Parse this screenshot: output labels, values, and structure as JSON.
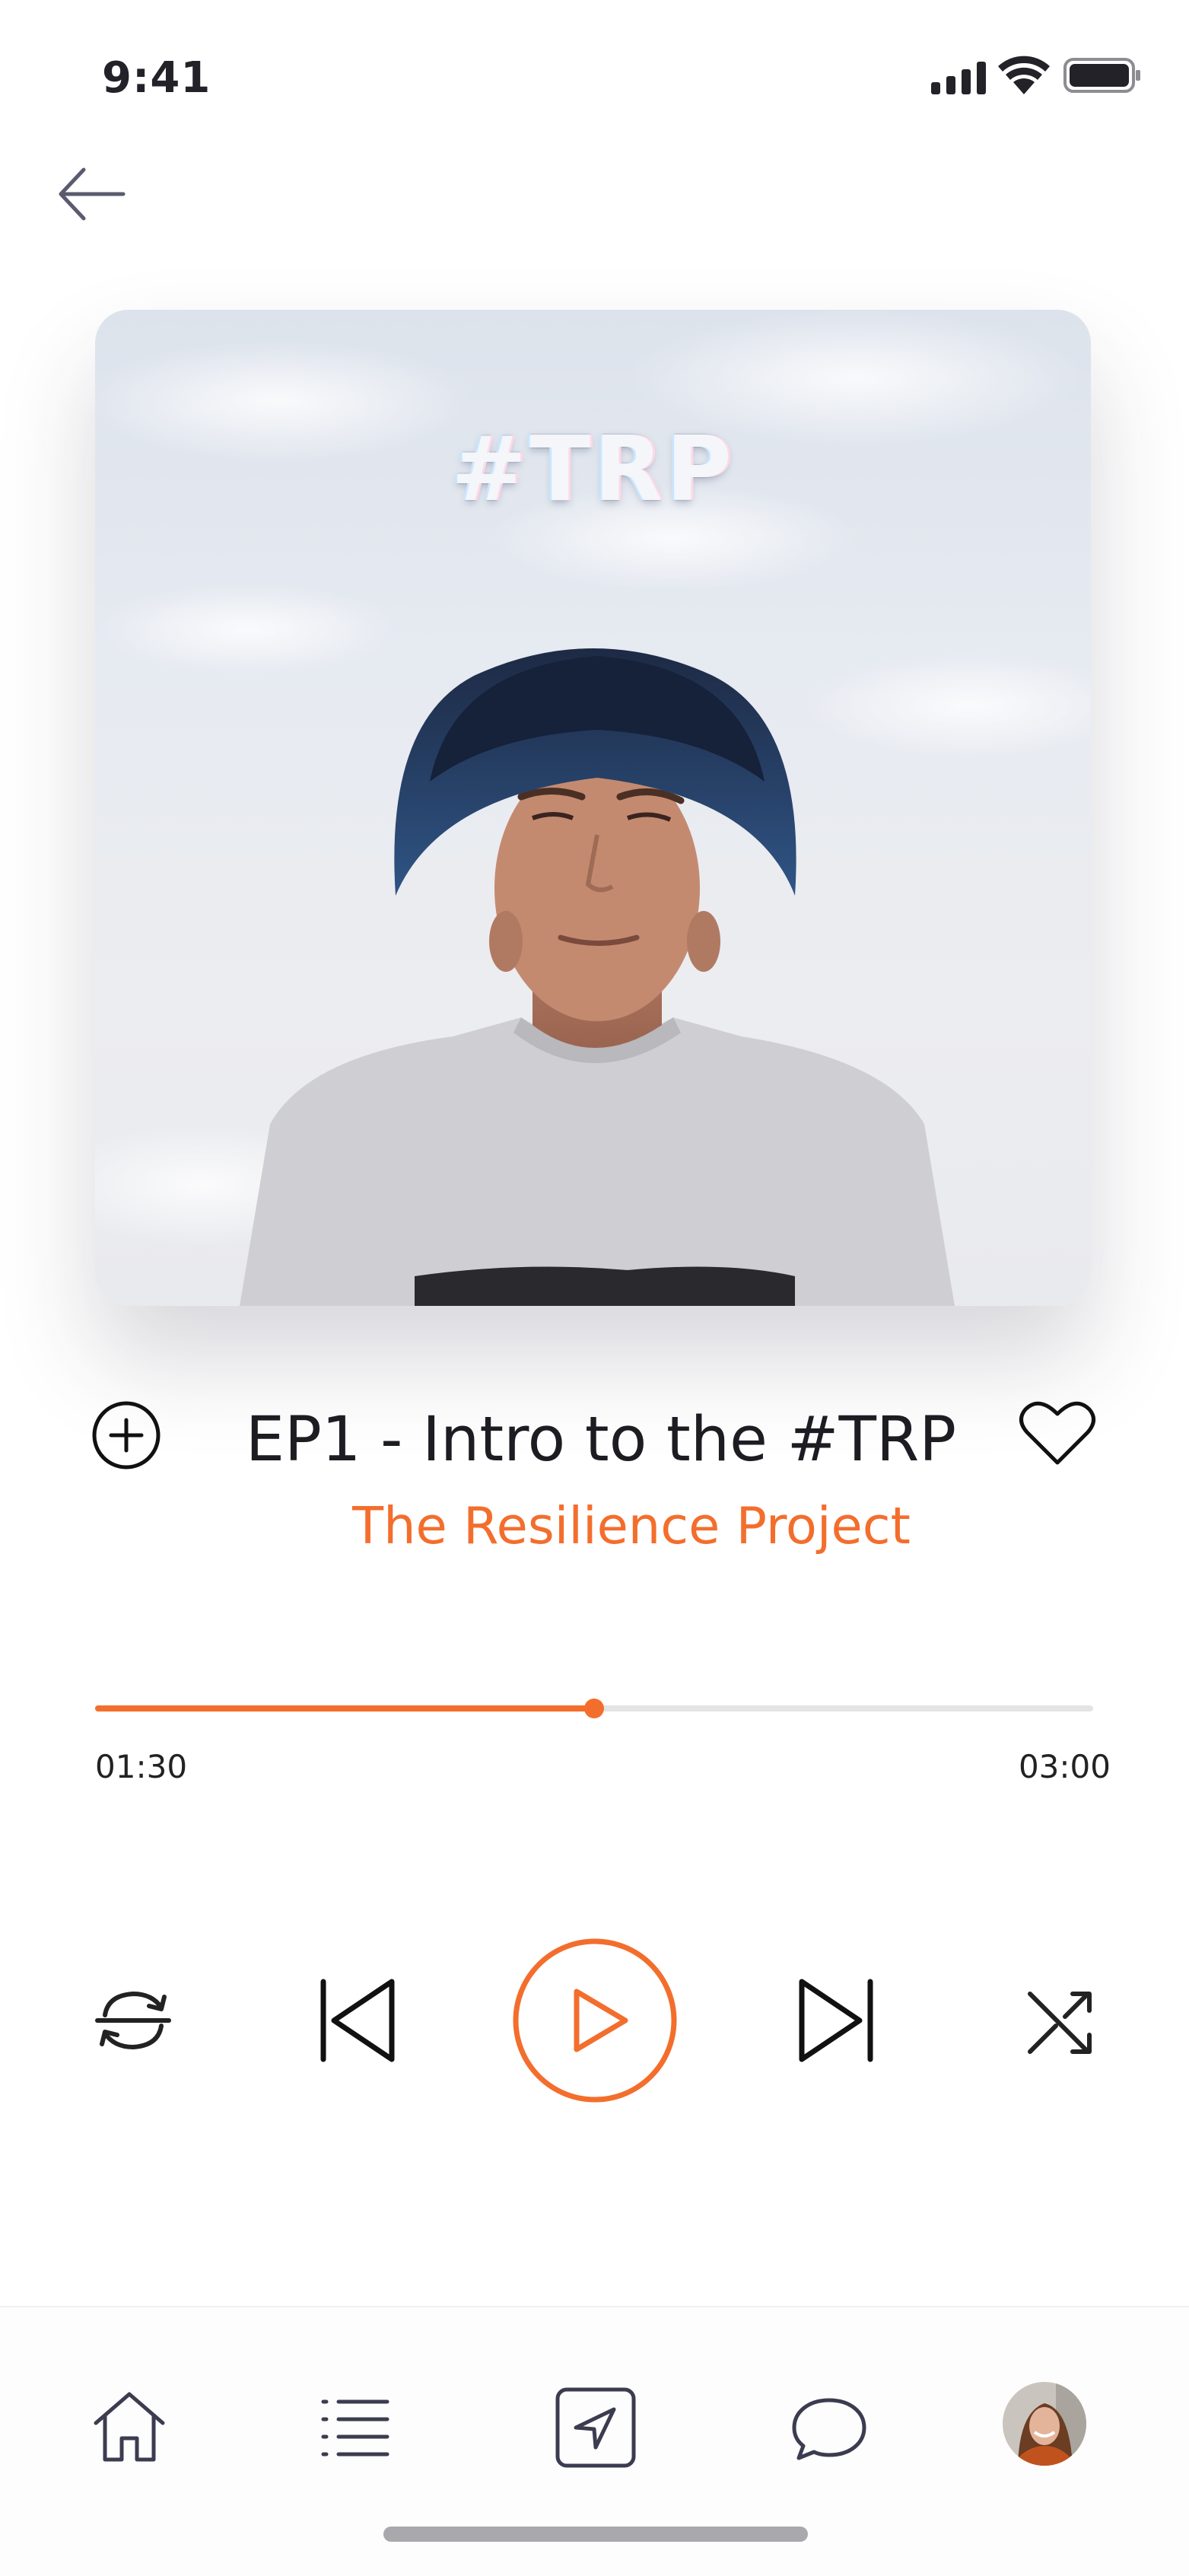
{
  "status_bar": {
    "time": "9:41"
  },
  "header": {
    "back_icon": "arrow-left-icon"
  },
  "artwork": {
    "overlay_text": "#TRP"
  },
  "track": {
    "title": "EP1 - Intro to the #TRP",
    "artist": "The Resilience Project",
    "add_icon": "plus-circle-icon",
    "like_icon": "heart-icon"
  },
  "player": {
    "elapsed": "01:30",
    "duration": "03:00",
    "progress_fraction": 0.5,
    "controls": {
      "repeat_icon": "repeat-icon",
      "previous_icon": "skip-back-icon",
      "play_icon": "play-icon",
      "next_icon": "skip-forward-icon",
      "shuffle_icon": "shuffle-icon"
    }
  },
  "bottom_nav": {
    "items": [
      {
        "icon": "home-icon"
      },
      {
        "icon": "list-icon"
      },
      {
        "icon": "compass-icon"
      },
      {
        "icon": "chat-icon"
      },
      {
        "icon": "avatar"
      }
    ]
  },
  "colors": {
    "accent": "#f36e2d",
    "text": "#1c1c22",
    "track_bg": "#e4e4e6"
  }
}
